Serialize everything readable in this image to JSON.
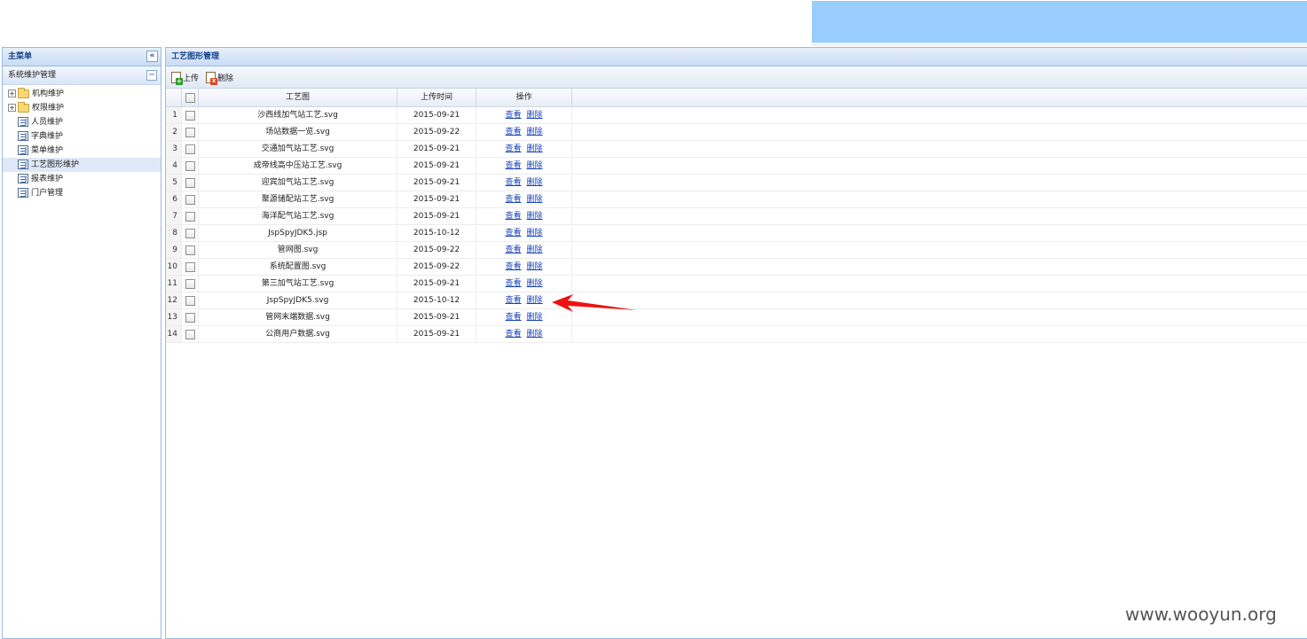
{
  "left_panel": {
    "title": "主菜单",
    "collapse_icon": "«",
    "section_title": "系统维护管理",
    "section_icon": "−",
    "tree": [
      {
        "label": "机构维护",
        "type": "folder",
        "expander": "+"
      },
      {
        "label": "权限维护",
        "type": "folder",
        "expander": "+"
      },
      {
        "label": "人员维护",
        "type": "page"
      },
      {
        "label": "字典维护",
        "type": "page"
      },
      {
        "label": "菜单维护",
        "type": "page"
      },
      {
        "label": "工艺图形维护",
        "type": "page",
        "selected": true
      },
      {
        "label": "报表维护",
        "type": "page"
      },
      {
        "label": "门户管理",
        "type": "page"
      }
    ]
  },
  "main_panel": {
    "title": "工艺图形管理",
    "toolbar": {
      "upload_label": "上传",
      "delete_label": "删除"
    },
    "columns": {
      "name": "工艺图",
      "time": "上传时间",
      "op": "操作"
    },
    "op_labels": {
      "view": "查看",
      "delete": "删除"
    },
    "rows": [
      {
        "num": "1",
        "name": "沙西线加气站工艺.svg",
        "time": "2015-09-21"
      },
      {
        "num": "2",
        "name": "场站数据一览.svg",
        "time": "2015-09-22"
      },
      {
        "num": "3",
        "name": "交通加气站工艺.svg",
        "time": "2015-09-21"
      },
      {
        "num": "4",
        "name": "成帝线高中压站工艺.svg",
        "time": "2015-09-21"
      },
      {
        "num": "5",
        "name": "迎宾加气站工艺.svg",
        "time": "2015-09-21"
      },
      {
        "num": "6",
        "name": "聚源储配站工艺.svg",
        "time": "2015-09-21"
      },
      {
        "num": "7",
        "name": "海洋配气站工艺.svg",
        "time": "2015-09-21"
      },
      {
        "num": "8",
        "name": "JspSpyJDK5.jsp",
        "time": "2015-10-12"
      },
      {
        "num": "9",
        "name": "管网图.svg",
        "time": "2015-09-22"
      },
      {
        "num": "10",
        "name": "系统配置图.svg",
        "time": "2015-09-22"
      },
      {
        "num": "11",
        "name": "第三加气站工艺.svg",
        "time": "2015-09-21"
      },
      {
        "num": "12",
        "name": "JspSpyJDK5.svg",
        "time": "2015-10-12"
      },
      {
        "num": "13",
        "name": "管网末端数据.svg",
        "time": "2015-09-21"
      },
      {
        "num": "14",
        "name": "公商用户数据.svg",
        "time": "2015-09-21"
      }
    ]
  },
  "annotation": {
    "arrow_color": "#ee1111"
  },
  "watermark": "www.wooyun.org"
}
